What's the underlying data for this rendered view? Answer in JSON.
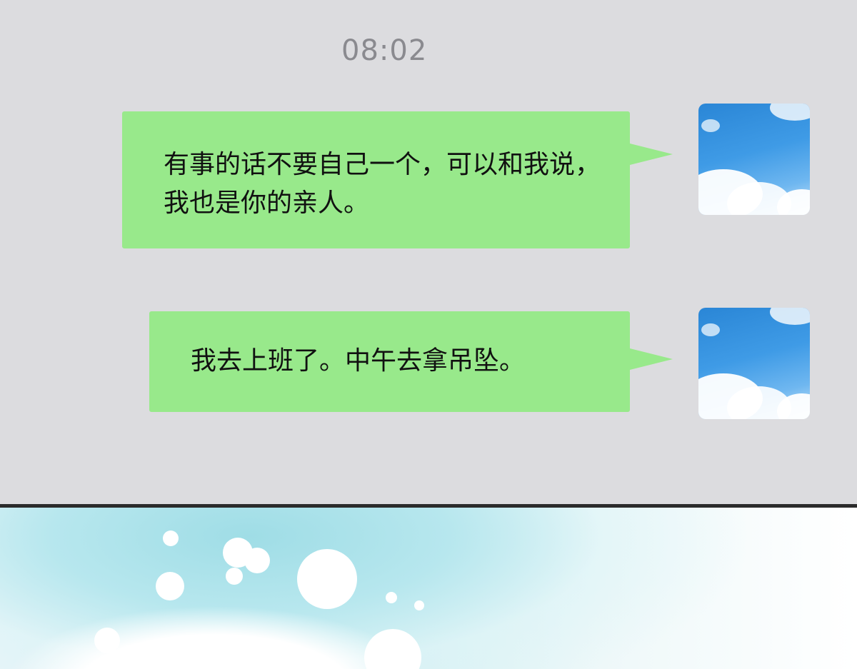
{
  "chat": {
    "timestamp": "08:02",
    "messages": [
      {
        "text": "有事的话不要自己一个，可以和我说，我也是你的亲人。",
        "sender": "self"
      },
      {
        "text": "我去上班了。中午去拿吊坠。",
        "sender": "self"
      }
    ],
    "colors": {
      "background": "#dcdcdf",
      "bubble": "#98e98b",
      "text": "#111111",
      "timestamp": "#8a8a8f"
    }
  }
}
